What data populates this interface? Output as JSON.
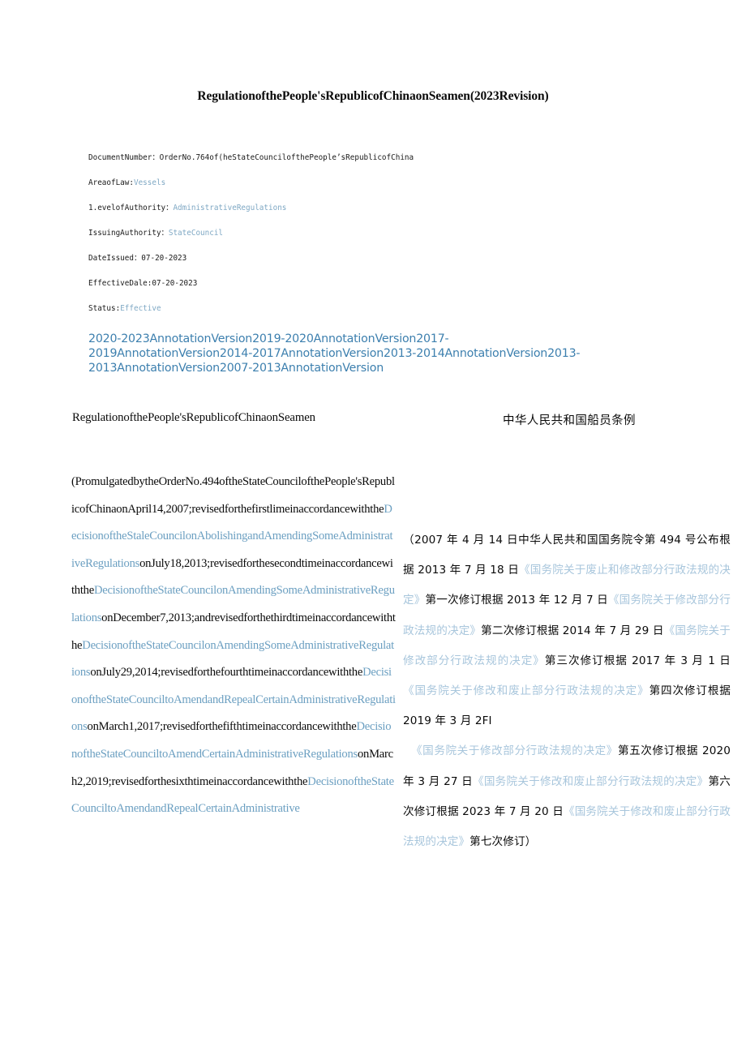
{
  "document": {
    "title": "RegulationofthePeople'sRepublicofChinaonSeamen(2023Revision)"
  },
  "metadata": [
    {
      "label": "DocumentNumber：",
      "value": "OrderNo.764of(heStateCouncilofthePeople’sRepublicofChina",
      "is_link": false
    },
    {
      "label": "AreaofLaw:",
      "value": "Vessels",
      "is_link": true
    },
    {
      "label": "1.evelofAuthority：",
      "value": "AdministrativeRegulations",
      "is_link": true
    },
    {
      "label": "IssuingAuthority：",
      "value": "StateCouncil",
      "is_link": true
    },
    {
      "label": "DateIssued：",
      "value": "07-20-2023",
      "is_link": false
    },
    {
      "label": "EffectiveDale:",
      "value": "07-20-2023",
      "is_link": false
    },
    {
      "label": "Status:",
      "value": "Effective",
      "is_link": true
    }
  ],
  "annotation_versions": [
    "2020-2023AnnotationVersion",
    "2019-2020AnnotationVersion",
    "2017-2019AnnotationVersion",
    "2014-2017AnnotationVersion",
    "2013-2014AnnotationVersion",
    "2013-2013AnnotationVersion",
    "2007-2013AnnotationVersion"
  ],
  "section_titles": {
    "english": "RegulationofthePeople'sRepublicofChinaonSeamen",
    "chinese": "中华人民共和国船员条例"
  },
  "body_english": {
    "runs": [
      {
        "text": "(PromulgatedbytheOrderNo.494oftheStateCouncilofthePeople'sRepublicofChinaonApril14,2007;revisedforthefirstlimeinaccordancewiththe",
        "link": false
      },
      {
        "text": "DecisionoftheStaleCouncilonAbolishingandAmendingSomeAdministrativeRegulations",
        "link": true
      },
      {
        "text": "onJuly18,2013;revisedforthesecondtimeinaccordancewiththe",
        "link": false
      },
      {
        "text": "DecisionoftheStateCouncilonAmendingSomeAdministrativeRegulations",
        "link": true
      },
      {
        "text": "onDecember7,2013;andrevisedforthethirdtimeinaccordancewiththe",
        "link": false
      },
      {
        "text": "DecisionoftheStateCouncilonAmendingSomeAdministrativeRegulations",
        "link": true
      },
      {
        "text": "onJuly29,2014;revisedforthefourthtimeinaccordancewiththe",
        "link": false
      },
      {
        "text": "DecisionoftheStateCounciltoAmendandRepealCertainAdministrativeRegulations",
        "link": true
      },
      {
        "text": "onMarch1,2017;revisedforthefifthtimeinaccordancewiththe",
        "link": false
      },
      {
        "text": "DecisionoftheStateCounciltoAmendCertainAdministrativeRegulations",
        "link": true
      },
      {
        "text": "onMarch2,2019;revisedforthesixthtimeinaccordancewiththe",
        "link": false
      },
      {
        "text": "DecisionoftheState",
        "link": true
      },
      {
        "text": " ",
        "link": false
      },
      {
        "text": "CounciltoAmendandRepealCertainAdministrative",
        "link": true
      }
    ]
  },
  "body_chinese": {
    "paragraph_1_runs": [
      {
        "text": "（2007 年 4 月 14 日中华人民共和国国务院令第 494 号公布根据 2013 年 7 月 18 日",
        "link": false
      },
      {
        "text": "《国务院关于废止和修改部分行政法规的决定》",
        "link": true
      },
      {
        "text": "第一次修订根据 2013 年 12 月 7 日",
        "link": false
      },
      {
        "text": "《国务院关于修改部分行政法规的决定》",
        "link": true
      },
      {
        "text": "第二次修订根据 2014 年 7 月 29 日",
        "link": false
      },
      {
        "text": "《国务院关于修改部分行政法规的决定》",
        "link": true
      },
      {
        "text": "第三次修订根据 2017 年 3 月 1 日",
        "link": false
      },
      {
        "text": "《国务院关于修改和废止部分行政法规的决定》",
        "link": true
      },
      {
        "text": "第四次修订根据 2019 年 3 月 2FI",
        "link": false
      }
    ],
    "paragraph_2_runs": [
      {
        "text": "《国务院关于修改部分行政法规的决定》",
        "link": true
      },
      {
        "text": "第五次修订根据 2020 年 3 月 27 日",
        "link": false
      },
      {
        "text": "《国务院关于修改和废止部分行政法规的决定》",
        "link": true
      },
      {
        "text": "第六次修订根据 2023 年 7 月 20 日",
        "link": false
      },
      {
        "text": "《国务院关于修改和废止部分行政法规的决定》",
        "link": true
      },
      {
        "text": "第七次修订）",
        "link": false
      }
    ]
  },
  "colors": {
    "annotation_link": "#3c7fae",
    "meta_link": "#7fa8c4",
    "body_link_en": "#6b9fc1",
    "body_link_zh": "#a8c6dc",
    "text": "#0a0a0a",
    "background": "#ffffff"
  }
}
